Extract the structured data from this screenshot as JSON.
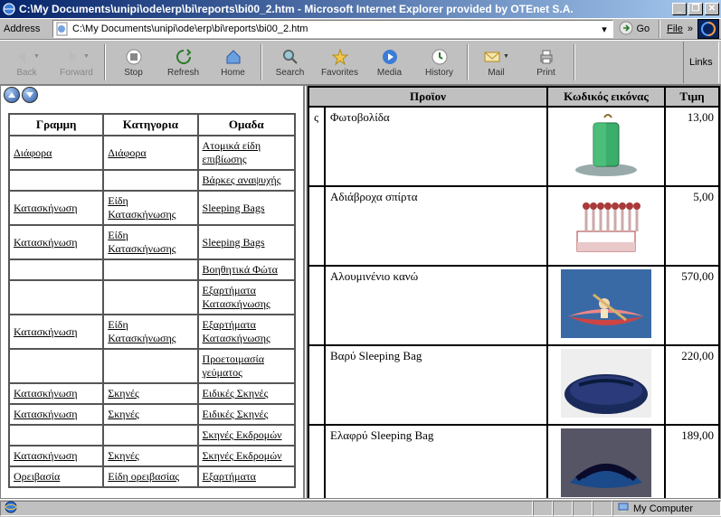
{
  "window": {
    "title": "C:\\My Documents\\unipi\\ode\\erp\\bi\\reports\\bi00_2.htm - Microsoft Internet Explorer provided by OTEnet S.A."
  },
  "address": {
    "label": "Address",
    "path": "C:\\My Documents\\unipi\\ode\\erp\\bi\\reports\\bi00_2.htm",
    "go": "Go",
    "file": "File",
    "links": "Links"
  },
  "toolbar": {
    "back": "Back",
    "forward": "Forward",
    "stop": "Stop",
    "refresh": "Refresh",
    "home": "Home",
    "search": "Search",
    "favorites": "Favorites",
    "media": "Media",
    "history": "History",
    "mail": "Mail",
    "print": "Print"
  },
  "left_table": {
    "headers": {
      "c1": "Γραμμη",
      "c2": "Κατηγορια",
      "c3": "Ομαδα"
    },
    "rows": [
      {
        "c1": "Διάφορα",
        "c2": "Διάφορα",
        "c3": "Ατομικά είδη επιβίωσης"
      },
      {
        "c1": "",
        "c2": "",
        "c3": "Βάρκες αναψυχής"
      },
      {
        "c1": "Κατασκήνωση",
        "c2": "Είδη Κατασκήνωσης",
        "c3": "Sleeping Bags"
      },
      {
        "c1": "Κατασκήνωση",
        "c2": "Είδη Κατασκήνωσης",
        "c3": "Sleeping Bags"
      },
      {
        "c1": "",
        "c2": "",
        "c3": "Βοηθητικά Φώτα"
      },
      {
        "c1": "",
        "c2": "",
        "c3": "Εξαρτήματα Κατασκήνωσης"
      },
      {
        "c1": "Κατασκήνωση",
        "c2": "Είδη Κατασκήνωσης",
        "c3": "Εξαρτήματα Κατασκήνωσης"
      },
      {
        "c1": "",
        "c2": "",
        "c3": "Προετοιμασία γεύματος"
      },
      {
        "c1": "Κατασκήνωση",
        "c2": "Σκηνές",
        "c3": "Ειδικές Σκηνές"
      },
      {
        "c1": "Κατασκήνωση",
        "c2": "Σκηνές",
        "c3": "Ειδικές Σκηνές"
      },
      {
        "c1": "",
        "c2": "",
        "c3": "Σκηνές Εκδρομών"
      },
      {
        "c1": "Κατασκήνωση",
        "c2": "Σκηνές",
        "c3": "Σκηνές Εκδρομών"
      },
      {
        "c1": "Ορειβασία",
        "c2": "Είδη ορειβασίας",
        "c3": "Εξαρτήματα"
      }
    ]
  },
  "right_table": {
    "headers": {
      "c0": "",
      "c1": "Προϊον",
      "c2": "Κωδικός εικόνας",
      "c3": "Τιμη"
    },
    "rows": [
      {
        "pre": "ς",
        "name": "Φωτοβολίδα",
        "img": "flare-green",
        "price": "13,00"
      },
      {
        "pre": "",
        "name": "Αδιάβροχα σπίρτα",
        "img": "matches",
        "price": "5,00"
      },
      {
        "pre": "",
        "name": "Αλουμινένιο κανώ",
        "img": "canoe",
        "price": "570,00"
      },
      {
        "pre": "",
        "name": "Βαρύ Sleeping Bag",
        "img": "sleeping-navy",
        "price": "220,00"
      },
      {
        "pre": "",
        "name": "Ελαφρύ Sleeping Bag",
        "img": "sleeping-blue",
        "price": "189,00"
      }
    ]
  },
  "status": {
    "zone": "My Computer"
  }
}
